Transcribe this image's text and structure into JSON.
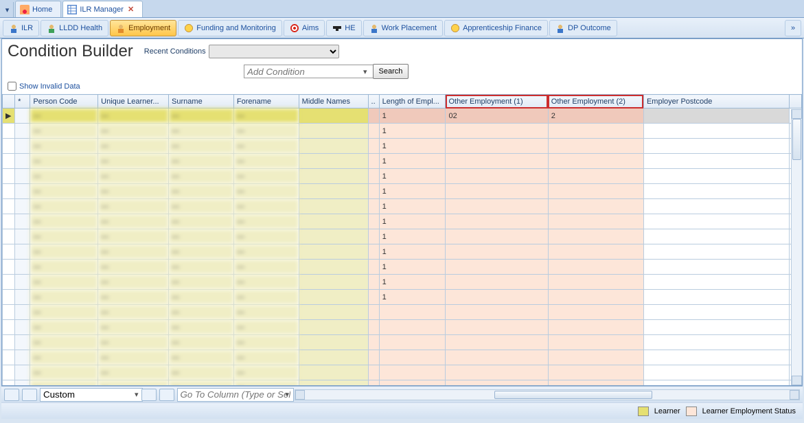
{
  "outer_tabs": {
    "home": "Home",
    "ilr_manager": "ILR Manager"
  },
  "ribbon": {
    "items": [
      {
        "label": "ILR",
        "icon": "person"
      },
      {
        "label": "LLDD Health",
        "icon": "person-green"
      },
      {
        "label": "Employment",
        "icon": "person-orange",
        "selected": true
      },
      {
        "label": "Funding and Monitoring",
        "icon": "coin"
      },
      {
        "label": "Aims",
        "icon": "target"
      },
      {
        "label": "HE",
        "icon": "cap"
      },
      {
        "label": "Work Placement",
        "icon": "person"
      },
      {
        "label": "Apprenticeship Finance",
        "icon": "coin"
      },
      {
        "label": "DP Outcome",
        "icon": "person"
      }
    ]
  },
  "builder": {
    "title": "Condition Builder",
    "recent_label": "Recent Conditions",
    "add_condition_placeholder": "Add Condition",
    "search_label": "Search",
    "show_invalid_label": "Show Invalid Data"
  },
  "grid": {
    "columns": {
      "star": "*",
      "person_code": "Person Code",
      "uln": "Unique Learner...",
      "surname": "Surname",
      "forename": "Forename",
      "middle": "Middle Names",
      "ellipsis": "..",
      "length": "Length of Empl...",
      "oe1": "Other Employment (1)",
      "oe2": "Other Employment (2)",
      "postcode": "Employer Postcode"
    },
    "rows": [
      {
        "sel": true,
        "len": "1",
        "oe1": "02",
        "oe2": "2"
      },
      {
        "len": "1"
      },
      {
        "len": "1"
      },
      {
        "len": "1"
      },
      {
        "len": "1"
      },
      {
        "len": "1"
      },
      {
        "len": "1"
      },
      {
        "len": "1"
      },
      {
        "len": "1"
      },
      {
        "len": "1"
      },
      {
        "len": "1"
      },
      {
        "len": "1"
      },
      {
        "len": "1"
      },
      {},
      {},
      {},
      {},
      {},
      {}
    ]
  },
  "footer": {
    "mode": "Custom",
    "goto_placeholder": "Go To Column (Type or Select)"
  },
  "legend": {
    "learner": "Learner",
    "emp_status": "Learner Employment Status"
  }
}
